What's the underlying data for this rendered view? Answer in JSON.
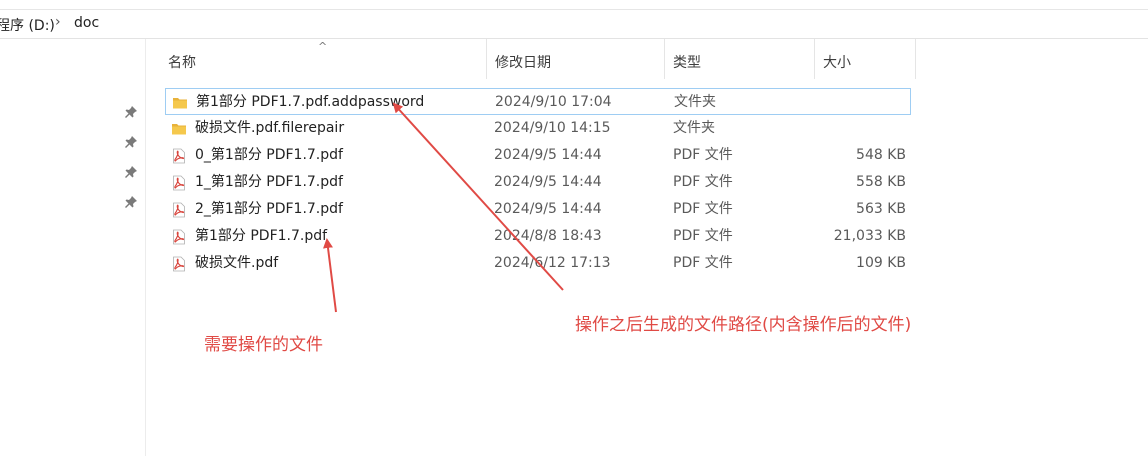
{
  "breadcrumb": {
    "drive": "程序 (D:)",
    "separator": "›",
    "folder": "doc"
  },
  "columns": {
    "name": "名称",
    "date": "修改日期",
    "type": "类型",
    "size": "大小"
  },
  "files": [
    {
      "name": "第1部分 PDF1.7.pdf.addpassword",
      "date": "2024/9/10 17:04",
      "type": "文件夹",
      "size": "",
      "icon": "folder-icon"
    },
    {
      "name": "破损文件.pdf.filerepair",
      "date": "2024/9/10 14:15",
      "type": "文件夹",
      "size": "",
      "icon": "folder-icon"
    },
    {
      "name": "0_第1部分 PDF1.7.pdf",
      "date": "2024/9/5 14:44",
      "type": "PDF 文件",
      "size": "548 KB",
      "icon": "pdf-file-icon"
    },
    {
      "name": "1_第1部分 PDF1.7.pdf",
      "date": "2024/9/5 14:44",
      "type": "PDF 文件",
      "size": "558 KB",
      "icon": "pdf-file-icon"
    },
    {
      "name": "2_第1部分 PDF1.7.pdf",
      "date": "2024/9/5 14:44",
      "type": "PDF 文件",
      "size": "563 KB",
      "icon": "pdf-file-icon"
    },
    {
      "name": "第1部分 PDF1.7.pdf",
      "date": "2024/8/8 18:43",
      "type": "PDF 文件",
      "size": "21,033 KB",
      "icon": "pdf-file-icon"
    },
    {
      "name": "破损文件.pdf",
      "date": "2024/6/12 17:13",
      "type": "PDF 文件",
      "size": "109 KB",
      "icon": "pdf-file-icon"
    }
  ],
  "annotations": {
    "source_file": "需要操作的文件",
    "output_path": "操作之后生成的文件路径(内含操作后的文件)"
  },
  "colors": {
    "annotation": "#e04a45",
    "selection_border": "#9ecdf3",
    "folder": "#e8b23a",
    "pdf": "#d9443c"
  }
}
